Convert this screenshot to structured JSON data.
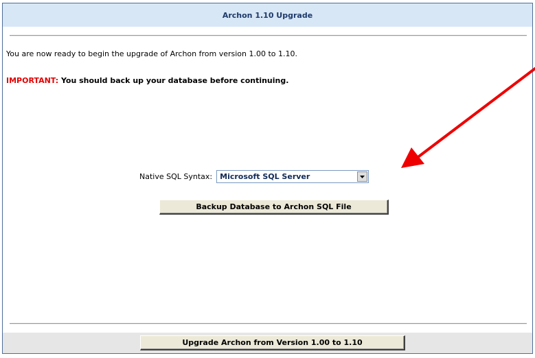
{
  "header": {
    "title": "Archon 1.10 Upgrade"
  },
  "main": {
    "intro_text": "You are now ready to begin the upgrade of Archon from version 1.00 to 1.10.",
    "important_label": "IMPORTANT:",
    "important_text": " You should back up your database before continuing.",
    "sql_syntax": {
      "label": "Native SQL Syntax:",
      "selected_value": "Microsoft SQL Server"
    },
    "backup_button_label": "Backup Database to Archon SQL File"
  },
  "footer": {
    "upgrade_button_label": "Upgrade Archon from Version 1.00 to 1.10"
  },
  "colors": {
    "header_bg": "#d7e7f6",
    "important": "#e10000",
    "annotation_arrow": "#ee0000"
  },
  "icons": {
    "dropdown": "chevron-down-icon",
    "annotation": "red-arrow-annotation"
  }
}
